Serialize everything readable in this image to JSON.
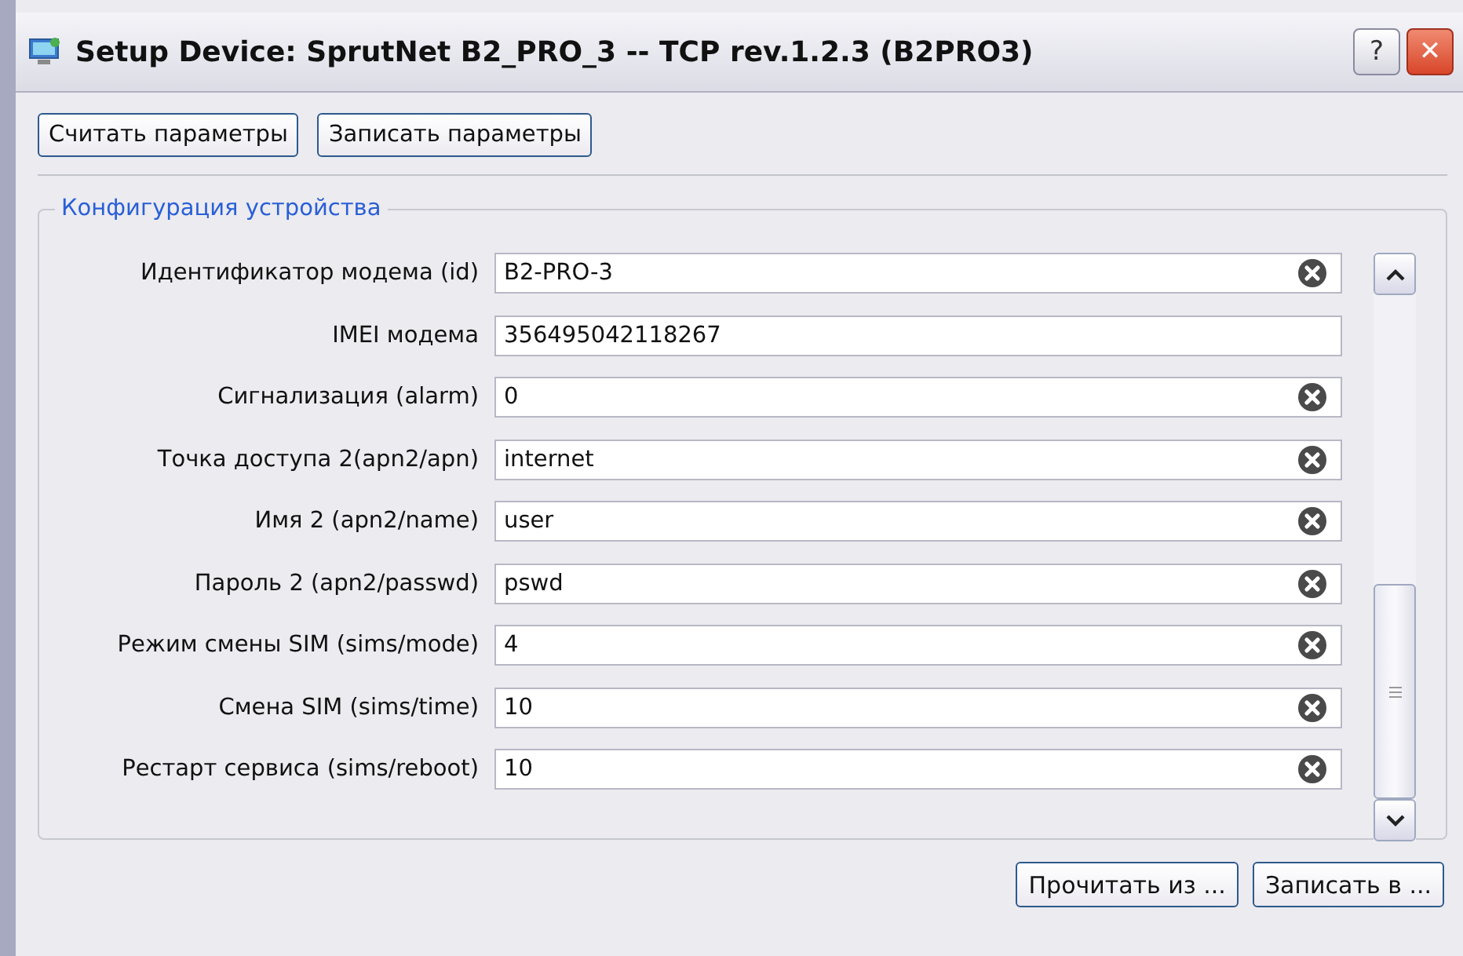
{
  "window": {
    "title": "Setup Device: SprutNet B2_PRO_3 -- TCP rev.1.2.3 (B2PRO3)",
    "help_button": "?",
    "close_button": "✕"
  },
  "toolbar": [
    "Считать параметры",
    "Записать параметры"
  ],
  "group": {
    "title": "Конфигурация устройства",
    "fields": [
      {
        "label": "Идентификатор модема (id)",
        "value": "B2-PRO-3",
        "clearable": true
      },
      {
        "label": "IMEI модема",
        "value": "356495042118267",
        "clearable": false
      },
      {
        "label": "Сигнализация (alarm)",
        "value": "0",
        "clearable": true
      },
      {
        "label": "Точка доступа 2(apn2/apn)",
        "value": "internet",
        "clearable": true
      },
      {
        "label": "Имя 2 (apn2/name)",
        "value": "user",
        "clearable": true
      },
      {
        "label": "Пароль 2 (apn2/passwd)",
        "value": "pswd",
        "clearable": true
      },
      {
        "label": "Режим смены SIM (sims/mode)",
        "value": "4",
        "clearable": true
      },
      {
        "label": "Смена SIM (sims/time)",
        "value": "10",
        "clearable": true
      },
      {
        "label": "Рестарт сервиса (sims/reboot)",
        "value": "10",
        "clearable": true
      }
    ]
  },
  "footer_buttons": [
    "Прочитать из ...",
    "Записать в ..."
  ]
}
